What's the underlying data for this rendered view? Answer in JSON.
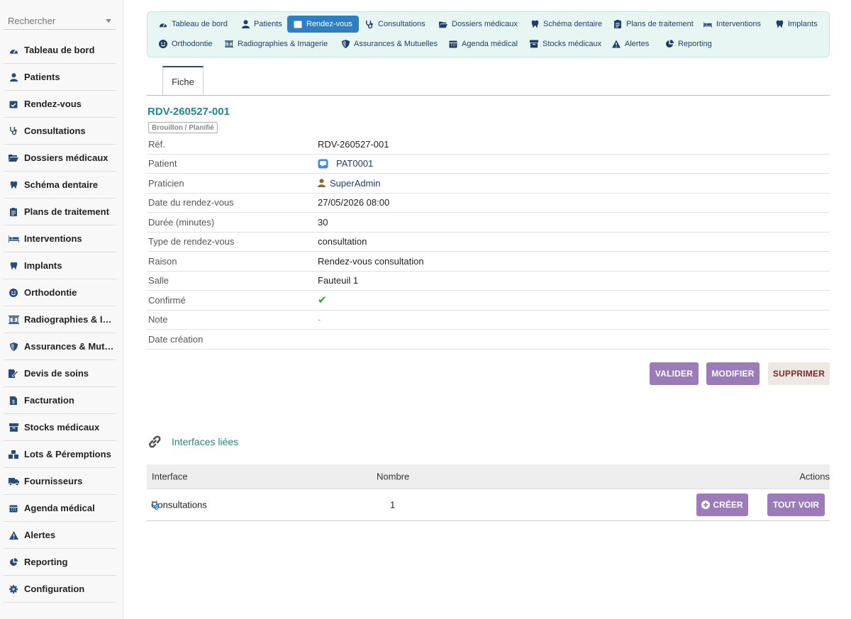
{
  "search": {
    "placeholder": "Rechercher"
  },
  "sidebar": {
    "items": [
      {
        "label": "Tableau de bord",
        "icon": "dashboard-icon"
      },
      {
        "label": "Patients",
        "icon": "user-icon"
      },
      {
        "label": "Rendez-vous",
        "icon": "calendar-check-icon"
      },
      {
        "label": "Consultations",
        "icon": "stethoscope-icon"
      },
      {
        "label": "Dossiers médicaux",
        "icon": "folder-open-icon"
      },
      {
        "label": "Schéma dentaire",
        "icon": "tooth-icon"
      },
      {
        "label": "Plans de traitement",
        "icon": "clipboard-icon"
      },
      {
        "label": "Interventions",
        "icon": "procedure-bed-icon"
      },
      {
        "label": "Implants",
        "icon": "tooth-icon"
      },
      {
        "label": "Orthodontie",
        "icon": "smile-icon"
      },
      {
        "label": "Radiographies & Imagerie",
        "icon": "xray-icon"
      },
      {
        "label": "Assurances & Mutuelles",
        "icon": "shield-icon"
      },
      {
        "label": "Devis de soins",
        "icon": "file-signature-icon"
      },
      {
        "label": "Facturation",
        "icon": "invoice-icon"
      },
      {
        "label": "Stocks médicaux",
        "icon": "box-icon"
      },
      {
        "label": "Lots & Péremptions",
        "icon": "boxes-icon"
      },
      {
        "label": "Fournisseurs",
        "icon": "truck-icon"
      },
      {
        "label": "Agenda médical",
        "icon": "calendar-icon"
      },
      {
        "label": "Alertes",
        "icon": "warning-icon"
      },
      {
        "label": "Reporting",
        "icon": "pie-chart-icon"
      },
      {
        "label": "Configuration",
        "icon": "gear-icon"
      }
    ]
  },
  "tabs": {
    "row1": [
      {
        "label": "Tableau de bord",
        "icon": "dashboard-icon"
      },
      {
        "label": "Patients",
        "icon": "user-icon"
      },
      {
        "label": "Rendez-vous",
        "icon": "calendar-check-icon",
        "active": true
      },
      {
        "label": "Consultations",
        "icon": "stethoscope-icon"
      },
      {
        "label": "Dossiers médicaux",
        "icon": "folder-open-icon"
      },
      {
        "label": "Schéma dentaire",
        "icon": "tooth-icon"
      },
      {
        "label": "Plans de traitement",
        "icon": "clipboard-icon"
      },
      {
        "label": "Interventions",
        "icon": "procedure-bed-icon"
      },
      {
        "label": "Implants",
        "icon": "tooth-icon"
      }
    ],
    "row2": [
      {
        "label": "Orthodontie",
        "icon": "smile-icon"
      },
      {
        "label": "Radiographies & Imagerie",
        "icon": "xray-icon"
      },
      {
        "label": "Assurances & Mutuelles",
        "icon": "shield-icon"
      },
      {
        "label": "Agenda médical",
        "icon": "calendar-icon"
      },
      {
        "label": "Stocks médicaux",
        "icon": "box-icon"
      },
      {
        "label": "Alertes",
        "icon": "warning-icon"
      },
      {
        "label": "Reporting",
        "icon": "pie-chart-icon"
      }
    ]
  },
  "card_tab": "Fiche",
  "record": {
    "ref_title": "RDV-260527-001",
    "status": "Brouillon / Planifié",
    "fields": [
      {
        "label": "Réf.",
        "value": "RDV-260527-001",
        "kind": "text"
      },
      {
        "label": "Patient",
        "value": "PAT0001",
        "kind": "patient-link"
      },
      {
        "label": "Praticien",
        "value": "SuperAdmin",
        "kind": "user-link"
      },
      {
        "label": "Date du rendez-vous",
        "value": "27/05/2026 08:00",
        "kind": "text"
      },
      {
        "label": "Durée (minutes)",
        "value": "30",
        "kind": "text"
      },
      {
        "label": "Type de rendez-vous",
        "value": "consultation",
        "kind": "text"
      },
      {
        "label": "Raison",
        "value": "Rendez-vous consultation",
        "kind": "text"
      },
      {
        "label": "Salle",
        "value": "Fauteuil 1",
        "kind": "text"
      },
      {
        "label": "Confirmé",
        "value": "✔",
        "kind": "check"
      },
      {
        "label": "Note",
        "value": "-",
        "kind": "dash"
      },
      {
        "label": "Date création",
        "value": "",
        "kind": "text"
      }
    ]
  },
  "actions": {
    "validate": "VALIDER",
    "modify": "MODIFIER",
    "delete": "SUPPRIMER"
  },
  "linked": {
    "title": "Interfaces liées",
    "headers": {
      "interface": "Interface",
      "count": "Nombre",
      "actions": "Actions"
    },
    "rows": [
      {
        "interface": "Consultations",
        "count": "1",
        "create": "CRÉER",
        "view_all": "TOUT VOIR"
      }
    ]
  },
  "colors": {
    "accent": "#1e8a8a",
    "active_tab": "#2d7fc1",
    "action_button": "#9b7bb8",
    "delete_button_bg": "#ece8e4",
    "link": "#1f3d68",
    "check": "#2e9e3e"
  }
}
